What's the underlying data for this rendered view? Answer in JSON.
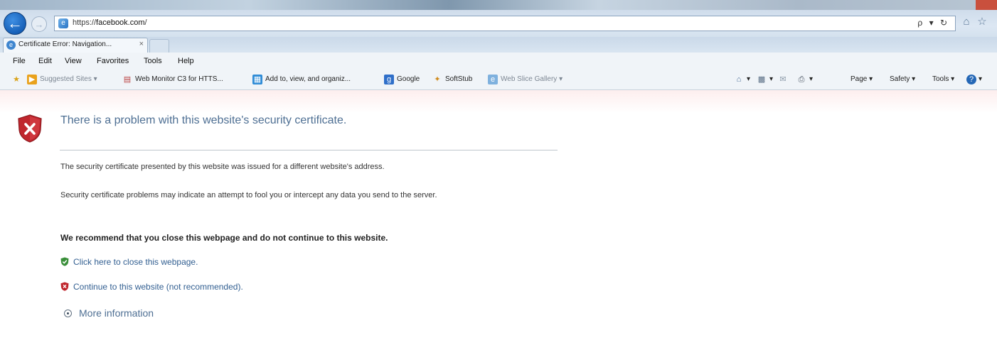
{
  "browser": {
    "address": {
      "scheme": "https://",
      "host": "facebook.com",
      "path": "/"
    },
    "address_tools": "ρ ▾ ↻",
    "tab": {
      "label": "Certificate Error: Navigation...",
      "close": "×"
    },
    "menu": [
      "File",
      "Edit",
      "View",
      "Favorites",
      "Tools",
      "Help"
    ],
    "favorites": [
      {
        "label": "Suggested Sites ▾",
        "dim": true
      },
      {
        "label": "Web Monitor C3 for HTTS..."
      },
      {
        "label": "Add to, view, and organiz..."
      },
      {
        "label": "Google"
      },
      {
        "label": "SoftStub"
      },
      {
        "label": "Web Slice Gallery ▾",
        "dim": true
      }
    ],
    "command_bar": {
      "page": "Page ▾",
      "safety": "Safety ▾",
      "tools": "Tools ▾"
    }
  },
  "page": {
    "title": "There is a problem with this website's security certificate.",
    "p1": "The security certificate presented by this website was issued for a different website's address.",
    "p2": "Security certificate problems may indicate an attempt to fool you or intercept any data you send to the server.",
    "recommend": "We recommend that you close this webpage and do not continue to this website.",
    "close_link": "Click here to close this webpage.",
    "continue_link": "Continue to this website (not recommended).",
    "more_info": "More information"
  },
  "colors": {
    "link": "#325f91",
    "title": "#4e6f93",
    "shield_red": "#c0262d",
    "shield_green": "#3a8f3a"
  }
}
